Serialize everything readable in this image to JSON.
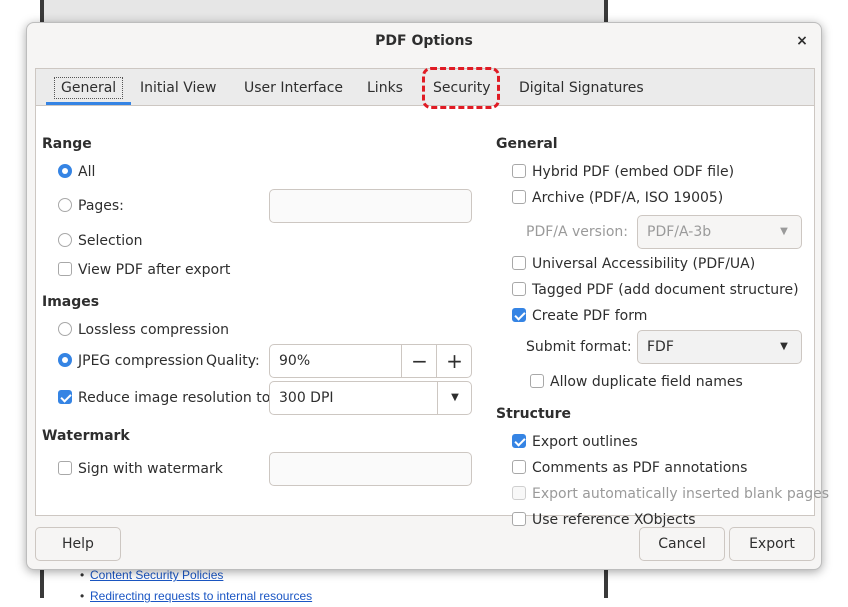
{
  "background": {
    "links": [
      "Content Security Policies",
      "Redirecting requests to internal resources"
    ]
  },
  "dialog": {
    "title": "PDF Options",
    "close_glyph": "×",
    "tabs": [
      "General",
      "Initial View",
      "User Interface",
      "Links",
      "Security",
      "Digital Signatures"
    ],
    "active_tab": "General",
    "highlighted_tab": "Security"
  },
  "left": {
    "range": {
      "heading": "Range",
      "all": "All",
      "pages": "Pages:",
      "pages_value": "",
      "selection": "Selection",
      "view_after_export": "View PDF after export"
    },
    "images": {
      "heading": "Images",
      "lossless": "Lossless compression",
      "jpeg": "JPEG compression",
      "quality_label": "Quality:",
      "quality_value": "90%",
      "minus": "−",
      "plus": "+",
      "reduce": "Reduce image resolution to:",
      "resolution_value": "300 DPI"
    },
    "watermark": {
      "heading": "Watermark",
      "sign": "Sign with watermark",
      "value": ""
    }
  },
  "right": {
    "general": {
      "heading": "General",
      "hybrid": "Hybrid PDF (embed ODF file)",
      "archive": "Archive (PDF/A, ISO 19005)",
      "pdfa_label": "PDF/A version:",
      "pdfa_value": "PDF/A-3b",
      "universal": "Universal Accessibility (PDF/UA)",
      "tagged": "Tagged PDF (add document structure)",
      "create_form": "Create PDF form",
      "submit_label": "Submit format:",
      "submit_value": "FDF",
      "allow_dup": "Allow duplicate field names"
    },
    "structure": {
      "heading": "Structure",
      "outlines": "Export outlines",
      "comments": "Comments as PDF annotations",
      "blank_pages": "Export automatically inserted blank pages",
      "xobjects": "Use reference XObjects"
    }
  },
  "buttons": {
    "help": "Help",
    "cancel": "Cancel",
    "export": "Export"
  },
  "states": {
    "range": "All",
    "compression": "JPEG",
    "view_after_export": false,
    "reduce_resolution": true,
    "sign_watermark": false,
    "hybrid": false,
    "archive": false,
    "universal": false,
    "tagged": false,
    "create_form": true,
    "allow_dup": false,
    "outlines": true,
    "comments": false,
    "blank_pages": false,
    "xobjects": false
  },
  "colors": {
    "accent": "#3584e4",
    "highlight": "#e01b24"
  }
}
